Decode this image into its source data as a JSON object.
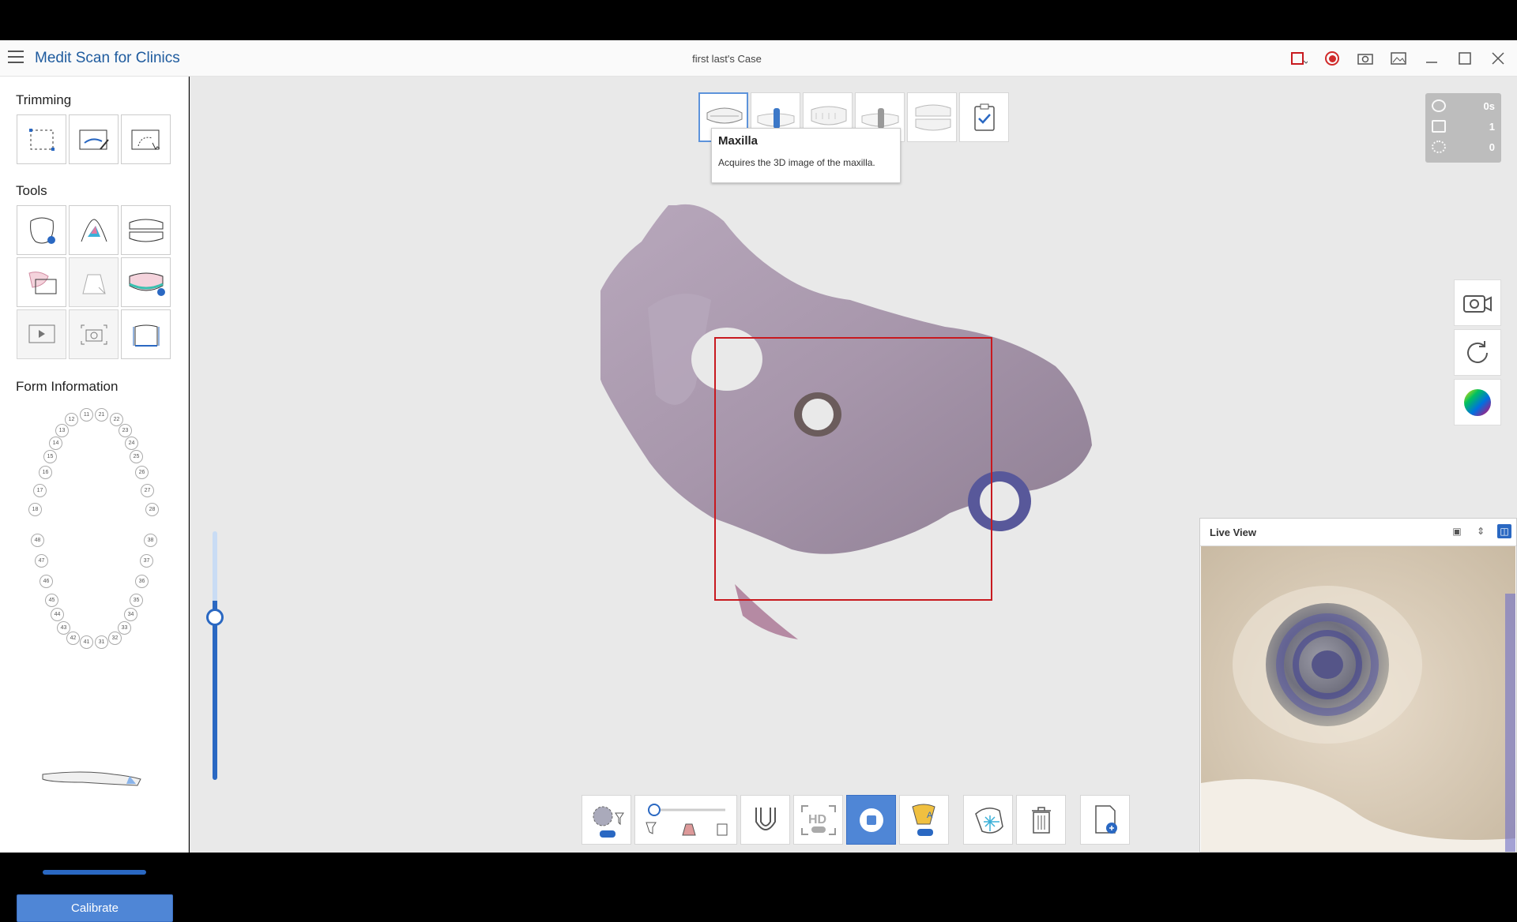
{
  "app": {
    "title_brand": "Medit",
    "title_rest": "Scan for Clinics",
    "case_title": "first last's Case"
  },
  "titlebar_icons": [
    "screen-capture-icon",
    "record-icon",
    "camera-icon",
    "gallery-icon",
    "minimize-icon",
    "maximize-icon",
    "close-icon"
  ],
  "sidebar": {
    "trimming_title": "Trimming",
    "tools_title": "Tools",
    "form_info_title": "Form Information",
    "calibrate_label": "Calibrate",
    "trimming_tools": [
      "select-area-icon",
      "brush-trim-icon",
      "lasso-trim-icon"
    ],
    "tools": [
      "lock-tooth-icon",
      "color-pick-icon",
      "occlusion-icon",
      "overlay-icon",
      "abutment-icon",
      "margin-icon",
      "play-video-icon",
      "snapshot-icon",
      "measure-icon"
    ]
  },
  "teeth": {
    "upper_right": [
      "11",
      "12",
      "13",
      "14",
      "15",
      "16",
      "17",
      "18"
    ],
    "upper_left": [
      "21",
      "22",
      "23",
      "24",
      "25",
      "26",
      "27",
      "28"
    ],
    "lower_left": [
      "31",
      "32",
      "33",
      "34",
      "35",
      "36",
      "37",
      "38"
    ],
    "lower_right": [
      "41",
      "42",
      "43",
      "44",
      "45",
      "46",
      "47",
      "48"
    ]
  },
  "steps": [
    "maxilla-step",
    "scanbody-step",
    "mandible-step",
    "implant-step",
    "occlusion-step",
    "review-step"
  ],
  "tooltip": {
    "title": "Maxilla",
    "description": "Acquires the 3D image of the maxilla."
  },
  "stats": {
    "time": "0s",
    "count1": "1",
    "count2": "0"
  },
  "side_buttons": [
    "video-camera-icon",
    "rotate-icon",
    "color-wheel-icon"
  ],
  "live_view": {
    "title": "Live View"
  },
  "bottom_toolbar": [
    "filter-on-icon",
    "scan-depth-slider",
    "tray-icon",
    "hd-off-icon",
    "stop-icon",
    "ai-filter-on-icon",
    "smart-scan-icon",
    "delete-icon",
    "export-icon"
  ],
  "colors": {
    "accent": "#2a68c2",
    "button": "#4f86d6",
    "roi_border": "#c8191f",
    "model": "#a594a9"
  }
}
